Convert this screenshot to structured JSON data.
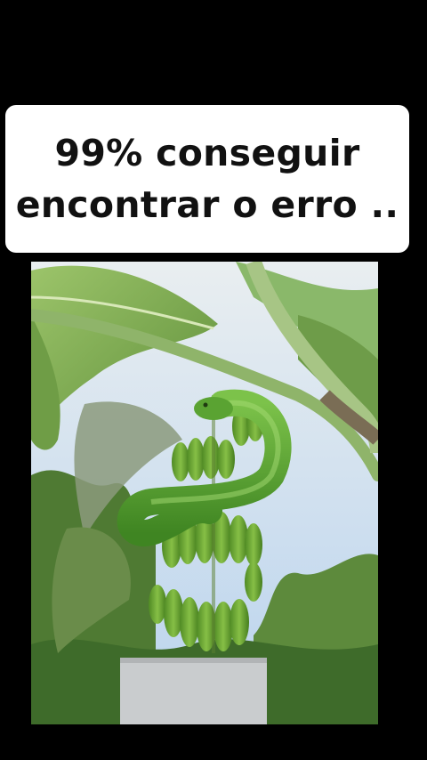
{
  "caption": {
    "line1": "99% conseguir",
    "line2": "encontrar o erro .."
  },
  "photo": {
    "subject": "green snake coiled among a bunch of green bananas on a banana tree"
  },
  "colors": {
    "background": "#000000",
    "caption_bg": "#ffffff",
    "caption_text": "#111111",
    "banana_green": "#6fa832",
    "snake_green": "#4f9a2c",
    "sky": "#cfe0f2"
  }
}
